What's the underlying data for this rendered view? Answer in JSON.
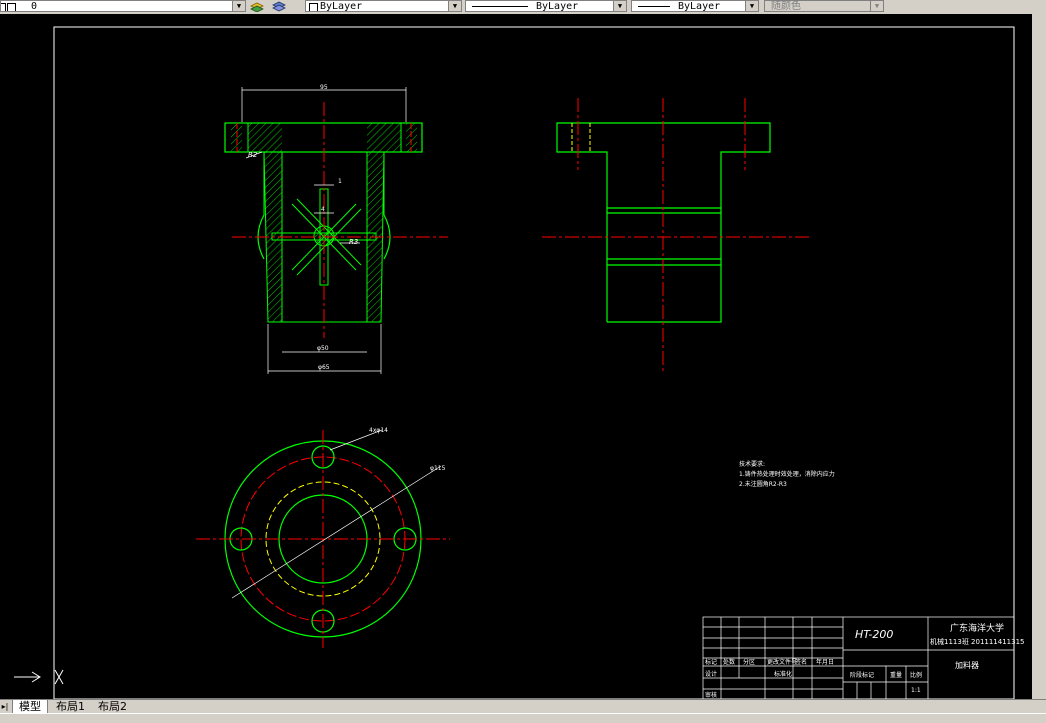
{
  "toolbar": {
    "layer_value": "0",
    "color_value": "ByLayer",
    "linetype_value": "ByLayer",
    "lineweight_value": "ByLayer",
    "plotstyle_value": "随颜色"
  },
  "drawing": {
    "dim_95": "95",
    "dim_r2_left": "R2",
    "dim_1": "1",
    "dim_4": "4",
    "dim_r3": "R3",
    "dim_phi50": "φ50",
    "dim_phi65": "φ65",
    "dim_holes": "4xφ14",
    "dim_phi115": "φ115"
  },
  "notes": {
    "heading": "技术要求:",
    "line1": "1.铸件热处理时效处理，消除内应力",
    "line2": "2.未注圆角R2-R3"
  },
  "title_block": {
    "material": "HT-200",
    "university": "广东海洋大学",
    "class_id": "机械1113班 201111411315",
    "part_name": "加料器",
    "h_mark": "标记",
    "h_count": "处数",
    "h_zone": "分区",
    "h_docno": "更改文件号",
    "h_sign": "签名",
    "h_date": "年月日",
    "h_design": "设计",
    "h_standardize": "标准化",
    "h_stage": "阶段标记",
    "h_weight": "重量",
    "h_scale": "比例",
    "scale_value": "1:1",
    "h_review": "审核"
  },
  "tabs": {
    "model": "模型",
    "layout1": "布局1",
    "layout2": "布局2"
  }
}
